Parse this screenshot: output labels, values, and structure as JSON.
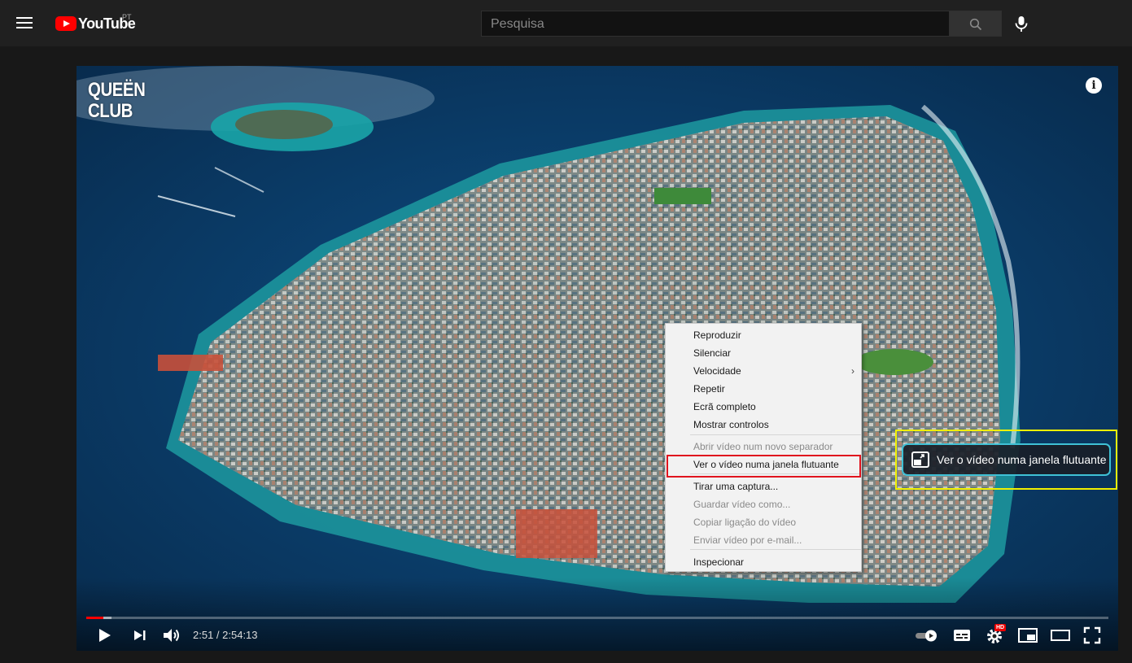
{
  "header": {
    "logo_text": "YouTube",
    "country_code": "PT",
    "search_placeholder": "Pesquisa"
  },
  "player": {
    "watermark_line1": "QUEËN",
    "watermark_line2": "CLUB",
    "info_glyph": "i",
    "time_display": "2:51 / 2:54:13",
    "progress_played_fraction": 0.0164,
    "progress_loaded_fraction": 0.025,
    "hd_badge": "HD"
  },
  "context_menu": {
    "items": [
      {
        "label": "Reproduzir",
        "enabled": true
      },
      {
        "label": "Silenciar",
        "enabled": true
      },
      {
        "label": "Velocidade",
        "enabled": true,
        "submenu": true
      },
      {
        "label": "Repetir",
        "enabled": true
      },
      {
        "label": "Ecrã completo",
        "enabled": true
      },
      {
        "label": "Mostrar controlos",
        "enabled": true
      },
      {
        "label": "Abrir vídeo num novo separador",
        "enabled": false
      },
      {
        "label": "Ver o vídeo numa janela flutuante",
        "enabled": true
      },
      {
        "label": "Tirar uma captura...",
        "enabled": true
      },
      {
        "label": "Guardar vídeo como...",
        "enabled": false
      },
      {
        "label": "Copiar ligação do vídeo",
        "enabled": false
      },
      {
        "label": "Enviar vídeo por e-mail...",
        "enabled": false
      },
      {
        "label": "Inspecionar",
        "enabled": true
      }
    ],
    "submenu_arrow": "›"
  },
  "pip_toggle": {
    "label": "Ver o vídeo numa janela flutuante"
  },
  "colors": {
    "accent_red": "#ff0000",
    "highlight_red": "#e0141e",
    "highlight_yellow": "#f0f000",
    "pip_border": "#3fc1d6"
  },
  "icons": {
    "menu": "hamburger-icon",
    "search": "search-icon",
    "mic": "microphone-icon",
    "play": "play-icon",
    "next": "next-icon",
    "volume": "volume-icon",
    "autoplay": "autoplay-toggle-icon",
    "subtitles": "subtitles-icon",
    "settings": "gear-icon",
    "miniplayer": "miniplayer-icon",
    "theater": "theater-mode-icon",
    "fullscreen": "fullscreen-icon",
    "pip": "picture-in-picture-icon",
    "info": "info-icon"
  }
}
